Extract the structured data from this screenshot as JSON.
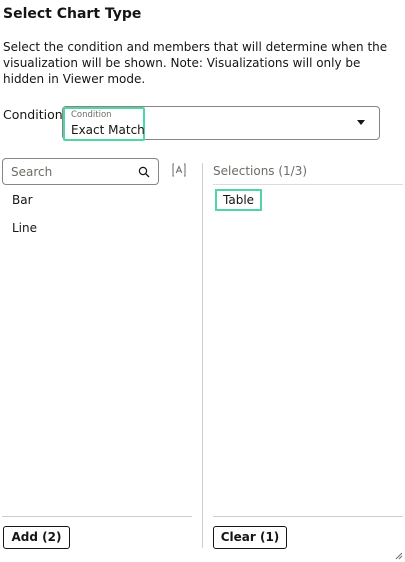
{
  "dialog": {
    "title": "Select Chart Type",
    "description": "Select the condition and members that will determine when the visualization will be shown. Note: Visualizations will only be hidden in Viewer mode."
  },
  "condition": {
    "label": "Condition",
    "field_label": "Condition",
    "value": "Exact Match"
  },
  "search": {
    "placeholder": "Search"
  },
  "available": {
    "items": [
      "Bar",
      "Line"
    ]
  },
  "selections": {
    "header": "Selections (1/3)",
    "items": [
      "Table"
    ]
  },
  "buttons": {
    "add_label": "Add (2)",
    "clear_label": "Clear (1)"
  },
  "icons": {
    "search": "search-icon",
    "sort": "sort-az-icon",
    "dropdown": "chevron-down-icon",
    "resize": "resize-handle-icon"
  },
  "colors": {
    "highlight": "#4ed6a5",
    "text": "#161513",
    "muted": "#6f6b66"
  }
}
